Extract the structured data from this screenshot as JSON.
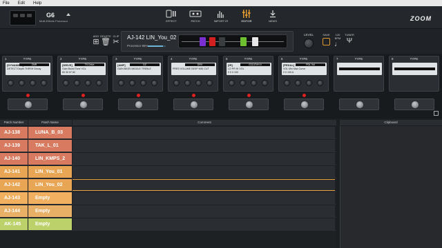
{
  "menu": {
    "items": [
      "File",
      "Edit",
      "Help"
    ]
  },
  "device": {
    "name": "G6",
    "subtitle": "Multi-Effects Processor"
  },
  "nav": [
    {
      "label": "EFFECT",
      "icon": "effect-icon",
      "active": false
    },
    {
      "label": "PATCH",
      "icon": "patch-icon",
      "active": false
    },
    {
      "label": "IMPORT IR",
      "icon": "import-ir-icon",
      "active": false
    },
    {
      "label": "EDITOR",
      "icon": "editor-icon",
      "active": true
    },
    {
      "label": "NEWS",
      "icon": "news-icon",
      "active": false
    }
  ],
  "brand": {
    "logo": "ZOOM"
  },
  "toolbar": {
    "add": "ADD",
    "delete": "DELETE",
    "clip": "CLIP"
  },
  "patch": {
    "name": "AJ-142 LIN_You_02",
    "processor_label": "Processor 86%",
    "processor_percent": 86
  },
  "chain_pedals": [
    {
      "color": "#7a2fd0"
    },
    {
      "color": "#d22020"
    },
    {
      "color": "#3a3d40"
    },
    {
      "color": "#6fc030"
    },
    {
      "color": "#e8e8e8"
    }
  ],
  "level": {
    "label": "LEVEL"
  },
  "right_tools": {
    "save": "SAVE",
    "bpm": "120 BPM",
    "tuner": "TUNER"
  },
  "accent": "#e09a30",
  "slots": [
    {
      "num": "1",
      "type": "TYPE",
      "category": "[DYNAMICS]",
      "effect": "ZNR",
      "params": "DETECT  Depth  THRSH  Decay",
      "values": "",
      "empty": false
    },
    {
      "num": "2",
      "type": "TYPE",
      "category": "[DRIVE]",
      "effect": "TS Drive",
      "params": "Gain  Boost  Tone  VOL",
      "values": "60  30  57  82",
      "empty": false
    },
    {
      "num": "3",
      "type": "TYPE",
      "category": "[AMP]",
      "effect": "DZ",
      "params": "GAIN  BASS  MIDDLE  TREBLE",
      "values": "",
      "empty": false
    },
    {
      "num": "4",
      "type": "TYPE",
      "category": "",
      "effect": "DRV",
      "params": "PRES  VOLUME  DEEP  MID CUT",
      "values": "",
      "empty": false
    },
    {
      "num": "5",
      "type": "TYPE",
      "category": "[IR]",
      "effect": "G12-EVH 4",
      "params": "LO  PR  HI  VOL",
      "values": "0  0  0  100",
      "empty": false
    },
    {
      "num": "6",
      "type": "TYPE",
      "category": "[PEDAL]",
      "effect": "PDL Vol",
      "params": "VOL  Min  Max  Curve",
      "values": "0  0  100  A",
      "empty": false
    },
    {
      "num": "7",
      "type": "TYPE",
      "category": "",
      "effect": "",
      "params": "",
      "values": "",
      "empty": true
    },
    {
      "num": "8",
      "type": "TYPE",
      "category": "",
      "effect": "",
      "params": "",
      "values": "",
      "empty": true
    }
  ],
  "list_headers": {
    "patch_number": "Patch Number",
    "patch_name": "Patch Name",
    "comment": "Comment",
    "clipboard": "Clipboard"
  },
  "patches": [
    {
      "number": "AJ-138",
      "name": "LUNA_B_03",
      "color": "#d77a5f",
      "selected": false
    },
    {
      "number": "AJ-139",
      "name": "TAK_L_01",
      "color": "#d77a5f",
      "selected": false
    },
    {
      "number": "AJ-140",
      "name": "LIN_KMPS_2",
      "color": "#d77a5f",
      "selected": false
    },
    {
      "number": "AJ-141",
      "name": "LIN_You_01",
      "color": "#e8a553",
      "selected": false
    },
    {
      "number": "AJ-142",
      "name": "LIN_You_02",
      "color": "#e8a553",
      "selected": true
    },
    {
      "number": "AJ-143",
      "name": "Empty",
      "color": "#f0b060",
      "selected": false
    },
    {
      "number": "AJ-144",
      "name": "Empty",
      "color": "#e8b066",
      "selected": false
    },
    {
      "number": "AK-145",
      "name": "Empty",
      "color": "#bcd16a",
      "selected": false
    }
  ]
}
